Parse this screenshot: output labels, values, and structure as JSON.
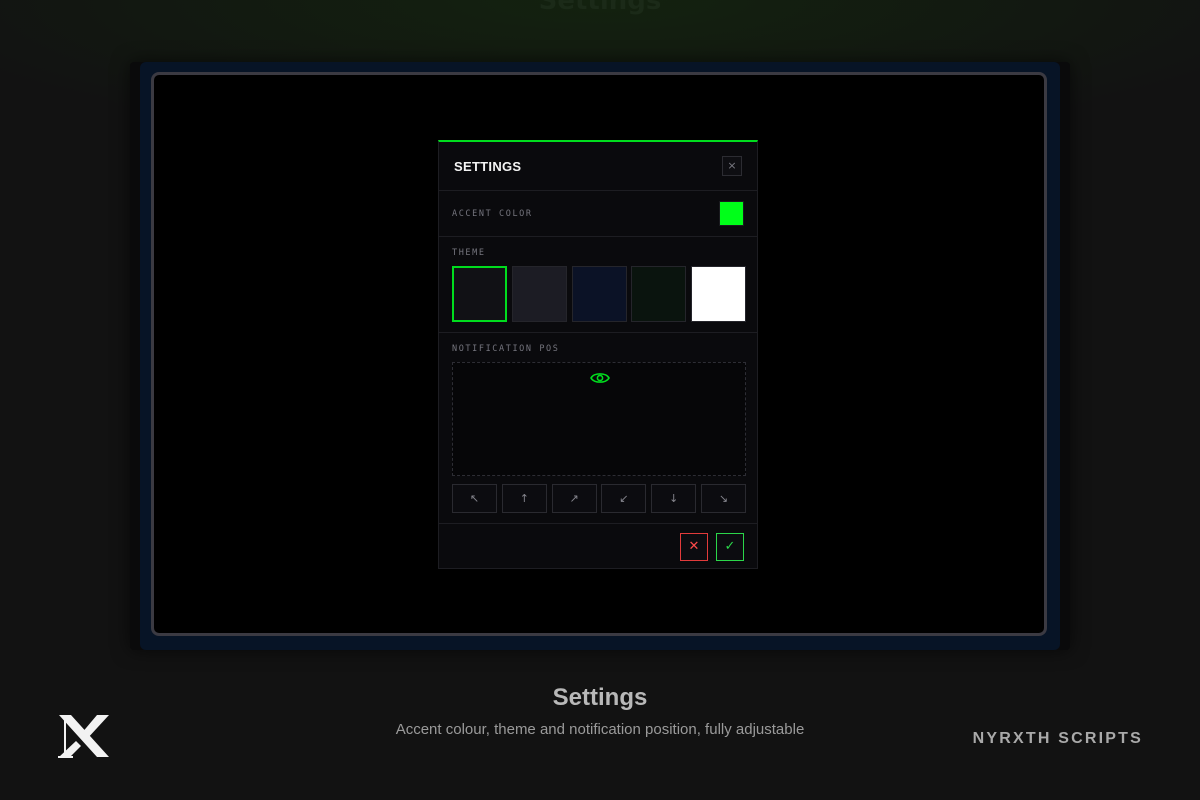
{
  "backdrop": {
    "title": "Settings"
  },
  "settings": {
    "title": "SETTINGS",
    "close_glyph": "×",
    "accent": {
      "label": "ACCENT COLOR",
      "color": "#00ff19"
    },
    "theme": {
      "label": "THEME",
      "options": [
        {
          "color": "#111115",
          "selected": true
        },
        {
          "color": "#1c1c24",
          "selected": false
        },
        {
          "color": "#0b1226",
          "selected": false
        },
        {
          "color": "#0a140e",
          "selected": false
        },
        {
          "color": "#ffffff",
          "selected": false
        }
      ]
    },
    "notification": {
      "label": "NOTIFICATION POS",
      "positions": [
        {
          "glyph": "↖",
          "icon": "arrow-up-left-icon"
        },
        {
          "glyph": "↑",
          "icon": "arrow-up-icon"
        },
        {
          "glyph": "↗",
          "icon": "arrow-up-right-icon"
        },
        {
          "glyph": "↙",
          "icon": "arrow-down-left-icon"
        },
        {
          "glyph": "↓",
          "icon": "arrow-down-icon"
        },
        {
          "glyph": "↘",
          "icon": "arrow-down-right-icon"
        }
      ]
    },
    "footer": {
      "cancel_glyph": "✕",
      "confirm_glyph": "✓"
    }
  },
  "caption": {
    "title": "Settings",
    "subtitle": "Accent colour, theme and notification position, fully adjustable"
  },
  "brand": {
    "name": "NYRXTH SCRIPTS"
  },
  "colors": {
    "accent": "#00dd1e",
    "cancel": "#ff4a4a",
    "confirm": "#2bd64a"
  }
}
